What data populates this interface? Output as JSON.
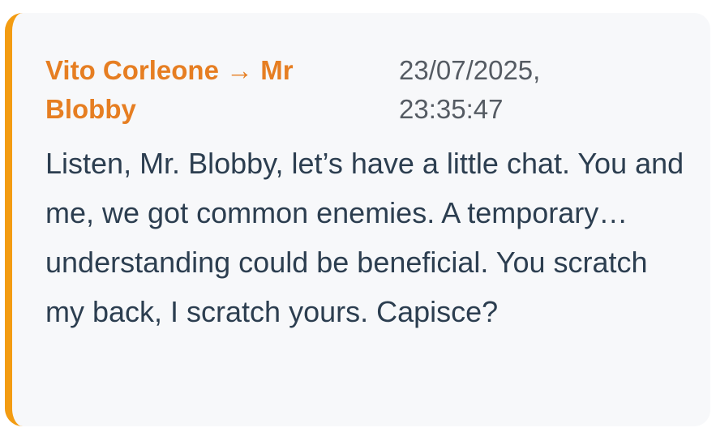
{
  "message": {
    "sender": "Vito Corleone",
    "arrow": "→",
    "recipient": "Mr Blobby",
    "timestamp": "23/07/2025, 23:35:47",
    "body": "Listen, Mr. Blobby, let’s have a little chat. You and me, we got common enemies. A temporary… understanding could be beneficial. You scratch my back, I scratch yours. Capisce?"
  },
  "colors": {
    "accent_bar": "#f39c12",
    "sender_text": "#e67e22",
    "timestamp_text": "#555b63",
    "body_text": "#2c3e50",
    "card_background": "#f7f8fa"
  }
}
